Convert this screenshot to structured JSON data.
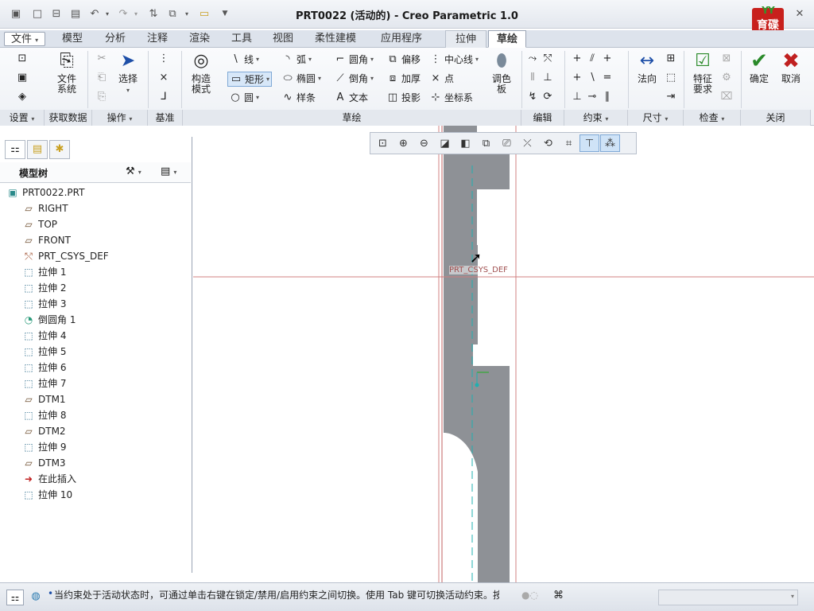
{
  "window": {
    "title": "PRT0022 (活动的) - Creo Parametric 1.0",
    "logo_text": "育碟\n软件"
  },
  "tabs": [
    {
      "label": "文件",
      "kind": "file"
    },
    {
      "label": "模型"
    },
    {
      "label": "分析"
    },
    {
      "label": "注释"
    },
    {
      "label": "渲染"
    },
    {
      "label": "工具"
    },
    {
      "label": "视图"
    },
    {
      "label": "柔性建模"
    },
    {
      "label": "应用程序"
    },
    {
      "label": "拉伸",
      "kind": "ext"
    },
    {
      "label": "草绘",
      "kind": "active"
    }
  ],
  "ribbon": {
    "ref_system": "文件\n系统",
    "select": "选择",
    "construct_mode": "构造\n模式",
    "line": "线",
    "rect": "矩形",
    "circle": "圆",
    "arc": "弧",
    "ellipse": "椭圆",
    "spline": "样条",
    "fillet": "圆角",
    "chamfer": "倒角",
    "text": "文本",
    "offset": "偏移",
    "thicken": "加厚",
    "project": "投影",
    "centerline": "中心线",
    "point": "点",
    "csys": "坐标系",
    "palette": "调色\n板",
    "normal": "法向",
    "feature_req": "特征\n要求",
    "ok": "确定",
    "cancel": "取消"
  },
  "groups": {
    "setup": "设置",
    "get_data": "获取数据",
    "operations": "操作",
    "datum": "基准",
    "sketch": "草绘",
    "edit": "编辑",
    "constrain": "约束",
    "dimension": "尺寸",
    "inspect": "检查",
    "close": "关闭"
  },
  "model_tree": {
    "title": "模型树",
    "items": [
      {
        "label": "PRT0022.PRT",
        "icon": "part-icon",
        "level": 0
      },
      {
        "label": "RIGHT",
        "icon": "datum-plane-icon",
        "level": 1
      },
      {
        "label": "TOP",
        "icon": "datum-plane-icon",
        "level": 1
      },
      {
        "label": "FRONT",
        "icon": "datum-plane-icon",
        "level": 1
      },
      {
        "label": "PRT_CSYS_DEF",
        "icon": "csys-icon",
        "level": 1
      },
      {
        "label": "拉伸 1",
        "icon": "extrude-icon",
        "level": 1
      },
      {
        "label": "拉伸 2",
        "icon": "extrude-icon",
        "level": 1
      },
      {
        "label": "拉伸 3",
        "icon": "extrude-icon",
        "level": 1
      },
      {
        "label": "倒圆角 1",
        "icon": "round-icon",
        "level": 1
      },
      {
        "label": "拉伸 4",
        "icon": "extrude-icon",
        "level": 1
      },
      {
        "label": "拉伸 5",
        "icon": "extrude-icon",
        "level": 1
      },
      {
        "label": "拉伸 6",
        "icon": "extrude-icon",
        "level": 1
      },
      {
        "label": "拉伸 7",
        "icon": "extrude-icon",
        "level": 1
      },
      {
        "label": "DTM1",
        "icon": "datum-plane-icon",
        "level": 1
      },
      {
        "label": "拉伸 8",
        "icon": "extrude-icon",
        "level": 1
      },
      {
        "label": "DTM2",
        "icon": "datum-plane-icon",
        "level": 1
      },
      {
        "label": "拉伸 9",
        "icon": "extrude-icon",
        "level": 1
      },
      {
        "label": "DTM3",
        "icon": "datum-plane-icon",
        "level": 1
      },
      {
        "label": "在此插入",
        "icon": "insert-here-icon",
        "level": 1
      },
      {
        "label": "拉伸 10",
        "icon": "extrude-new-icon",
        "level": 1
      }
    ]
  },
  "graphics": {
    "csys_label": "PRT_CSYS_DEF"
  },
  "status": {
    "message": "当约束处于活动状态时，可通过单击右键在锁定/禁用/启用约束之间切换。使用 Tab 键可切换活动约束。按住"
  },
  "colors": {
    "accent": "#2a8a2a",
    "cancel": "#c02020",
    "part_fill": "#8e9196",
    "datum_line": "#c87070",
    "sketch_line": "#1fb0b0"
  }
}
